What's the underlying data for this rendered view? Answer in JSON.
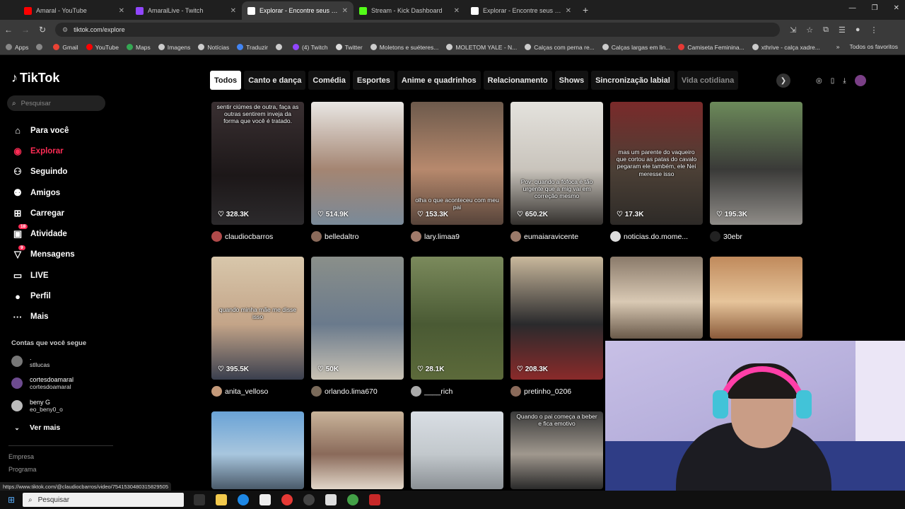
{
  "browser": {
    "tabs": [
      {
        "title": "Amaral - YouTube",
        "color": "#ff0000",
        "active": false
      },
      {
        "title": "AmaralLive - Twitch",
        "color": "#9146ff",
        "active": false
      },
      {
        "title": "Explorar - Encontre seus vídeos",
        "color": "#ffffff",
        "active": true
      },
      {
        "title": "Stream - Kick Dashboard",
        "color": "#53fc18",
        "active": false
      },
      {
        "title": "Explorar - Encontre seus vídeos",
        "color": "#ffffff",
        "active": false
      }
    ],
    "url": "tiktok.com/explore",
    "bookmarks": [
      {
        "label": "Apps",
        "color": "#888888"
      },
      {
        "label": "",
        "color": "#888888"
      },
      {
        "label": "Gmail",
        "color": "#ea4335"
      },
      {
        "label": "YouTube",
        "color": "#ff0000"
      },
      {
        "label": "Maps",
        "color": "#34a853"
      },
      {
        "label": "Imagens",
        "color": "#cccccc"
      },
      {
        "label": "Notícias",
        "color": "#cccccc"
      },
      {
        "label": "Traduzir",
        "color": "#4285f4"
      },
      {
        "label": "",
        "color": "#cccccc"
      },
      {
        "label": "(4) Twitch",
        "color": "#9146ff"
      },
      {
        "label": "Twitter",
        "color": "#dddddd"
      },
      {
        "label": "Moletons e suéteres...",
        "color": "#cccccc"
      },
      {
        "label": "MOLETOM YALE - N...",
        "color": "#cccccc"
      },
      {
        "label": "Calças com perna re...",
        "color": "#cccccc"
      },
      {
        "label": "Calças largas em lin...",
        "color": "#cccccc"
      },
      {
        "label": "Camiseta Feminina...",
        "color": "#e53935"
      },
      {
        "label": "xthrive - calça xadre...",
        "color": "#cccccc"
      }
    ],
    "bookmarks_more": "»",
    "all_bookmarks": "Todos os favoritos"
  },
  "sidebar": {
    "logo": "TikTok",
    "search_placeholder": "Pesquisar",
    "menu": [
      {
        "label": "Para você",
        "icon": "home-icon",
        "glyph": "⌂",
        "active": false,
        "badge": ""
      },
      {
        "label": "Explorar",
        "icon": "compass-icon",
        "glyph": "◉",
        "active": true,
        "badge": ""
      },
      {
        "label": "Seguindo",
        "icon": "following-icon",
        "glyph": "⚇",
        "active": false,
        "badge": ""
      },
      {
        "label": "Amigos",
        "icon": "friends-icon",
        "glyph": "⚉",
        "active": false,
        "badge": ""
      },
      {
        "label": "Carregar",
        "icon": "upload-icon",
        "glyph": "⊞",
        "active": false,
        "badge": ""
      },
      {
        "label": "Atividade",
        "icon": "activity-icon",
        "glyph": "▣",
        "active": false,
        "badge": "18"
      },
      {
        "label": "Mensagens",
        "icon": "messages-icon",
        "glyph": "▽",
        "active": false,
        "badge": "9"
      },
      {
        "label": "LIVE",
        "icon": "live-icon",
        "glyph": "▭",
        "active": false,
        "badge": ""
      },
      {
        "label": "Perfil",
        "icon": "profile-icon",
        "glyph": "●",
        "active": false,
        "badge": ""
      },
      {
        "label": "Mais",
        "icon": "more-icon",
        "glyph": "···",
        "active": false,
        "badge": ""
      }
    ],
    "following_header": "Contas que você segue",
    "accounts": [
      {
        "name": ".",
        "handle": "stllucas",
        "color": "#777777"
      },
      {
        "name": "cortesdoamaral",
        "handle": "cortesdoamaral",
        "color": "#6d4b8f"
      },
      {
        "name": "beny G",
        "handle": "eo_beny0_o",
        "color": "#bbbbbb"
      }
    ],
    "see_more": "Ver mais",
    "footer": [
      "Empresa",
      "Programa"
    ]
  },
  "categories": [
    "Todos",
    "Canto e dança",
    "Comédia",
    "Esportes",
    "Anime e quadrinhos",
    "Relacionamento",
    "Shows",
    "Sincronização labial",
    "Vida cotidiana"
  ],
  "videos": [
    {
      "likes": "328.3K",
      "author": "claudiocbarros",
      "caption": "sentir ciúmes de outra, faça as outras sentirem inveja da forma que você é tratado.",
      "bg": "linear-gradient(180deg,#3a3032,#1c1718 60%,#2c2a2c)",
      "avatar": "#b04a4a"
    },
    {
      "likes": "514.9K",
      "author": "belledaltro",
      "caption": "",
      "bg": "linear-gradient(180deg,#e9e7e4,#a48572 55%,#7a8a99)",
      "avatar": "#8a6a5a"
    },
    {
      "likes": "153.3K",
      "author": "lary.limaa9",
      "caption": "olha o que aconteceu com meu pai",
      "bg": "linear-gradient(180deg,#6d5a4c,#b7896d 55%,#57443a)",
      "avatar": "#a07a6a"
    },
    {
      "likes": "650.2K",
      "author": "eumaiaravicente",
      "caption": "Pov: quando a fofoca é tão urgente que a mig vai em correção mesmo",
      "bg": "linear-gradient(180deg,#e4e2dd,#c9c4bc 55%,#33302d)",
      "avatar": "#9a7a6a"
    },
    {
      "likes": "17.3K",
      "author": "noticias.do.mome...",
      "caption": "mas um parente do vaqueiro que cortou as patas do cavalo pegaram ele também, ele Nei meresse isso",
      "bg": "linear-gradient(180deg,#7a2a2a,#4c4036 55%,#2d2a27)",
      "avatar": "#dddddd"
    },
    {
      "likes": "195.3K",
      "author": "30ebr",
      "caption": "",
      "bg": "linear-gradient(180deg,#6c8a5a,#3a3a38 55%,#8f8c88)",
      "avatar": "#222222"
    },
    {
      "likes": "395.5K",
      "author": "anita_velloso",
      "caption": "quando minha mãe me disse isso",
      "bg": "linear-gradient(180deg,#d8c7ab,#c3a488 55%,#3a3f4e)",
      "avatar": "#c49a7a"
    },
    {
      "likes": "50K",
      "author": "orlando.lima670",
      "caption": "",
      "bg": "linear-gradient(180deg,#8a8f8a,#6a7a8c 55%,#c9c2b4)",
      "avatar": "#7a6a5a"
    },
    {
      "likes": "28.1K",
      "author": "____rich",
      "caption": "",
      "bg": "linear-gradient(180deg,#7b8a5c,#4a5a34 55%,#5c6a3a)",
      "avatar": "#aaaaaa"
    },
    {
      "likes": "208.3K",
      "author": "pretinho_0206",
      "caption": "",
      "bg": "linear-gradient(180deg,#c9b89c,#2a2a2c 55%,#8a2a2a)",
      "avatar": "#8a6a5a"
    },
    {
      "likes": "",
      "author": "",
      "caption": "",
      "bg": "linear-gradient(180deg,#8a7a6a,#d9c9b4 55%,#6a5a4a)",
      "avatar": "#888888"
    },
    {
      "likes": "",
      "author": "",
      "caption": "",
      "bg": "linear-gradient(180deg,#c08a5c,#e6c49a 55%,#8a5a3a)",
      "avatar": "#888888"
    },
    {
      "likes": "",
      "author": "",
      "caption": "",
      "bg": "linear-gradient(180deg,#6aa3d6,#a8c6de 55%,#4a5a6a)",
      "avatar": "#888888"
    },
    {
      "likes": "",
      "author": "",
      "caption": "",
      "bg": "linear-gradient(180deg,#c9b49a,#8a6a5a 55%,#e1d6c8)",
      "avatar": "#888888"
    },
    {
      "likes": "",
      "author": "",
      "caption": "",
      "bg": "linear-gradient(180deg,#d9dee4,#c2c8cc 55%,#8a8f94)",
      "avatar": "#888888"
    },
    {
      "likes": "",
      "author": "",
      "caption": "Quando o pai começa a beber e fica emotivo",
      "bg": "linear-gradient(180deg,#3a3a3a,#a0988e 55%,#2a2a2a)",
      "avatar": "#888888"
    }
  ],
  "status_url": "https://www.tiktok.com/@claudiocbarros/video/7541530480315829505",
  "taskbar": {
    "search_placeholder": "Pesquisar"
  },
  "theme": {
    "accent": "#fe2c55",
    "page_bg": "#000000"
  }
}
